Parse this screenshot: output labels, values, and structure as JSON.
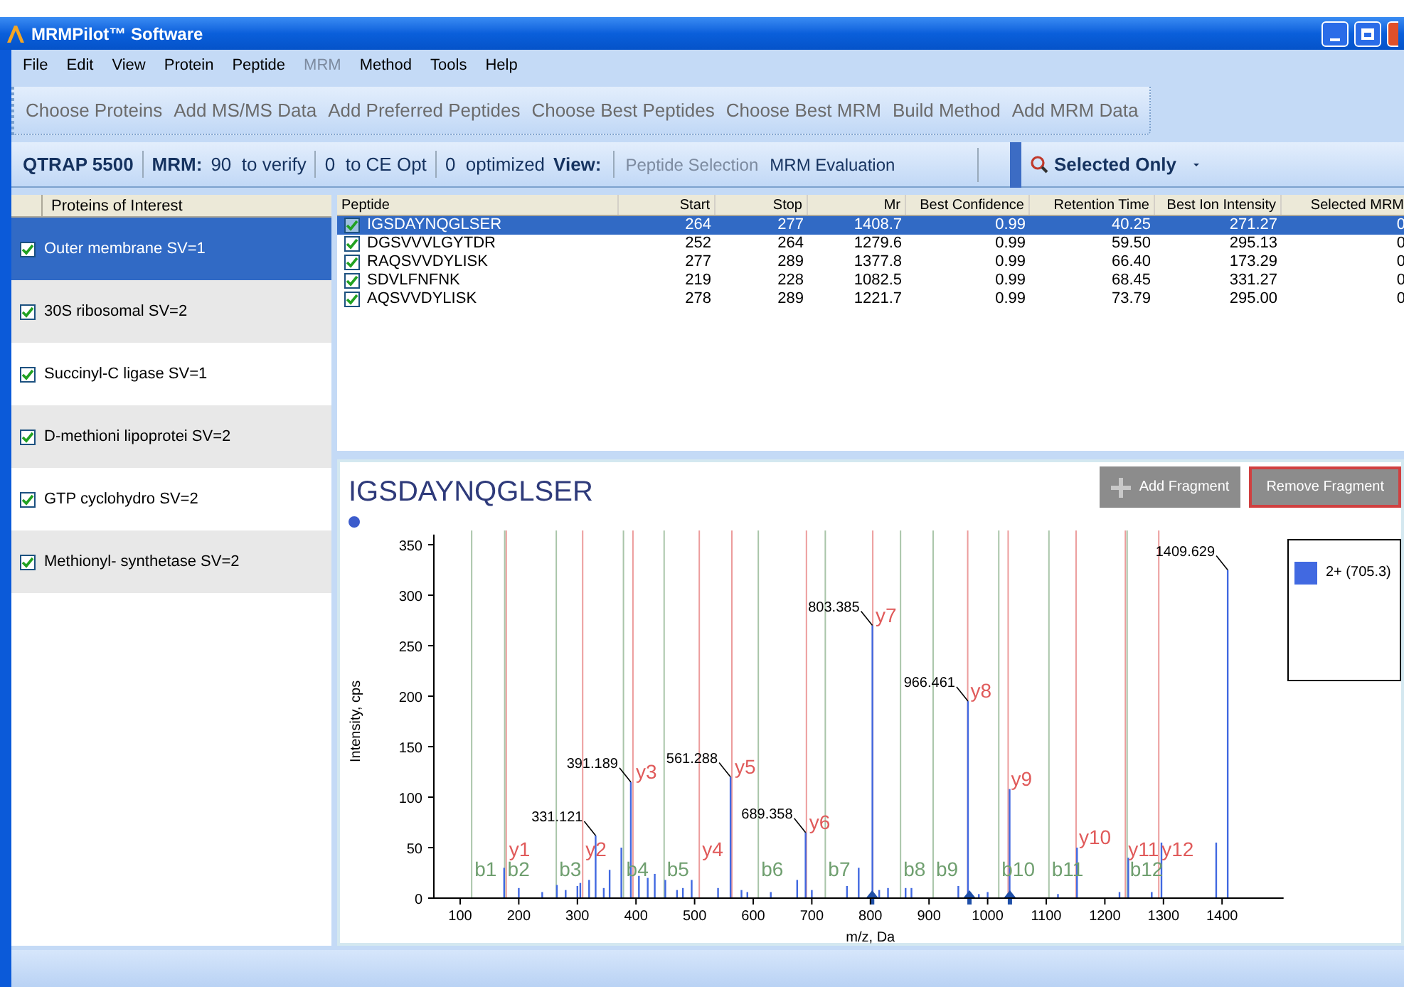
{
  "window": {
    "title": "MRMPilot™ Software"
  },
  "menu": [
    {
      "label": "File",
      "disabled": false
    },
    {
      "label": "Edit",
      "disabled": false
    },
    {
      "label": "View",
      "disabled": false
    },
    {
      "label": "Protein",
      "disabled": false
    },
    {
      "label": "Peptide",
      "disabled": false
    },
    {
      "label": "MRM",
      "disabled": true
    },
    {
      "label": "Method",
      "disabled": false
    },
    {
      "label": "Tools",
      "disabled": false
    },
    {
      "label": "Help",
      "disabled": false
    }
  ],
  "workflow": [
    "Choose Proteins",
    "Add MS/MS Data",
    "Add Preferred Peptides",
    "Choose Best Peptides",
    "Choose Best MRM",
    "Build Method",
    "Add MRM Data"
  ],
  "status_toolbar": {
    "instrument": "QTRAP 5500",
    "mrm_label": "MRM:",
    "to_verify": "90  to verify",
    "to_ce_opt": "0  to CE Opt",
    "optimized": "0  optimized",
    "view_label": "View:",
    "views": [
      {
        "label": "Peptide Selection",
        "disabled": true
      },
      {
        "label": "MRM Evaluation",
        "disabled": false
      }
    ],
    "filter": "Selected Only"
  },
  "proteins": {
    "header": "Proteins of Interest",
    "items": [
      {
        "label": "Outer membrane SV=1",
        "checked": true,
        "selected": true
      },
      {
        "label": "30S ribosomal SV=2",
        "checked": true,
        "selected": false
      },
      {
        "label": "Succinyl-C ligase SV=1",
        "checked": true,
        "selected": false
      },
      {
        "label": "D-methioni lipoprotei SV=2",
        "checked": true,
        "selected": false
      },
      {
        "label": "GTP cyclohydro SV=2",
        "checked": true,
        "selected": false
      },
      {
        "label": "Methionyl- synthetase SV=2",
        "checked": true,
        "selected": false
      }
    ]
  },
  "peptides": {
    "columns": [
      "Peptide",
      "Start",
      "Stop",
      "Mr",
      "Best Confidence",
      "Retention Time",
      "Best Ion Intensity",
      "Selected MRM"
    ],
    "rows": [
      {
        "cells": [
          "IGSDAYNQGLSER",
          "264",
          "277",
          "1408.7",
          "0.99",
          "40.25",
          "271.27",
          "0"
        ],
        "checked": true,
        "selected": true
      },
      {
        "cells": [
          "DGSVVVLGYTDR",
          "252",
          "264",
          "1279.6",
          "0.99",
          "59.50",
          "295.13",
          "0"
        ],
        "checked": true,
        "selected": false
      },
      {
        "cells": [
          "RAQSVVDYLISK",
          "277",
          "289",
          "1377.8",
          "0.99",
          "66.40",
          "173.29",
          "0"
        ],
        "checked": true,
        "selected": false
      },
      {
        "cells": [
          "SDVLFNFNK",
          "219",
          "228",
          "1082.5",
          "0.99",
          "68.45",
          "331.27",
          "0"
        ],
        "checked": true,
        "selected": false
      },
      {
        "cells": [
          "AQSVVDYLISK",
          "278",
          "289",
          "1221.7",
          "0.99",
          "73.79",
          "295.00",
          "0"
        ],
        "checked": true,
        "selected": false
      }
    ]
  },
  "spectrum": {
    "title": "IGSDAYNQGLSER",
    "buttons": [
      {
        "label": "Add Fragment",
        "kind": "add"
      },
      {
        "label": "Remove Fragment",
        "kind": "remove"
      }
    ],
    "chart_data": {
      "type": "bar",
      "xlabel": "m/z, Da",
      "ylabel": "Intensity, cps",
      "xlim": [
        55,
        1505
      ],
      "ylim": [
        0,
        360
      ],
      "xticks": [
        100,
        200,
        300,
        400,
        500,
        600,
        700,
        800,
        900,
        1000,
        1100,
        1200,
        1300,
        1400
      ],
      "yticks": [
        0,
        50,
        100,
        150,
        200,
        250,
        300,
        350
      ],
      "x": [
        175,
        200,
        240,
        265,
        280,
        300,
        305,
        320,
        331.121,
        345,
        355,
        375,
        391.189,
        405,
        420,
        432,
        450,
        470,
        480,
        495,
        540,
        561.288,
        580,
        590,
        630,
        675,
        689.358,
        700,
        760,
        780,
        803.385,
        815,
        830,
        860,
        870,
        950,
        966.461,
        985,
        1000,
        1037.5,
        1120,
        1152.5,
        1225,
        1240,
        1280,
        1296.6,
        1390,
        1409.629
      ],
      "series": [
        {
          "name": "2+ (705.3)",
          "color": "#4169e1",
          "values": [
            30,
            10,
            6,
            13,
            8,
            12,
            15,
            18,
            62,
            10,
            28,
            50,
            115,
            22,
            20,
            24,
            18,
            8,
            10,
            18,
            10,
            120,
            8,
            6,
            6,
            18,
            65,
            8,
            12,
            30,
            270,
            8,
            10,
            10,
            10,
            12,
            195,
            4,
            6,
            108,
            4,
            50,
            6,
            40,
            6,
            55,
            55,
            325
          ]
        }
      ],
      "annotations": [
        {
          "text": "331.121",
          "x": 331.121,
          "y": 62
        },
        {
          "text": "391.189",
          "x": 391.189,
          "y": 115
        },
        {
          "text": "561.288",
          "x": 561.288,
          "y": 120
        },
        {
          "text": "689.358",
          "x": 689.358,
          "y": 65
        },
        {
          "text": "803.385",
          "x": 803.385,
          "y": 270
        },
        {
          "text": "966.461",
          "x": 966.461,
          "y": 195
        },
        {
          "text": "1409.629",
          "x": 1409.629,
          "y": 325
        }
      ],
      "ref_lines": [
        {
          "axis": "x",
          "value": 119.6,
          "label": "b1",
          "color": "#6f9f6f"
        },
        {
          "axis": "x",
          "value": 178.6,
          "label": "y1",
          "color": "#e05a5a"
        },
        {
          "axis": "x",
          "value": 176,
          "label": "b2",
          "color": "#6f9f6f"
        },
        {
          "axis": "x",
          "value": 264,
          "label": "b3",
          "color": "#6f9f6f"
        },
        {
          "axis": "x",
          "value": 309,
          "label": "y2",
          "color": "#e05a5a"
        },
        {
          "axis": "x",
          "value": 378.6,
          "label": "b4",
          "color": "#6f9f6f"
        },
        {
          "axis": "x",
          "value": 394.8,
          "label": "y3",
          "color": "#e05a5a"
        },
        {
          "axis": "x",
          "value": 448,
          "label": "b5",
          "color": "#6f9f6f"
        },
        {
          "axis": "x",
          "value": 508,
          "label": "y4",
          "color": "#e05a5a"
        },
        {
          "axis": "x",
          "value": 563.6,
          "label": "y5",
          "color": "#e05a5a"
        },
        {
          "axis": "x",
          "value": 608.7,
          "label": "b6",
          "color": "#6f9f6f"
        },
        {
          "axis": "x",
          "value": 690.8,
          "label": "y6",
          "color": "#e05a5a"
        },
        {
          "axis": "x",
          "value": 723,
          "label": "b7",
          "color": "#6f9f6f"
        },
        {
          "axis": "x",
          "value": 804,
          "label": "y7",
          "color": "#e05a5a"
        },
        {
          "axis": "x",
          "value": 851.4,
          "label": "b8",
          "color": "#6f9f6f"
        },
        {
          "axis": "x",
          "value": 907,
          "label": "b9",
          "color": "#6f9f6f"
        },
        {
          "axis": "x",
          "value": 966,
          "label": "y8",
          "color": "#e05a5a"
        },
        {
          "axis": "x",
          "value": 1019,
          "label": "b10",
          "color": "#6f9f6f"
        },
        {
          "axis": "x",
          "value": 1035,
          "label": "y9",
          "color": "#e05a5a"
        },
        {
          "axis": "x",
          "value": 1104.6,
          "label": "b11",
          "color": "#6f9f6f"
        },
        {
          "axis": "x",
          "value": 1150.9,
          "label": "y10",
          "color": "#e05a5a"
        },
        {
          "axis": "x",
          "value": 1235,
          "label": "y11",
          "color": "#e05a5a"
        },
        {
          "axis": "x",
          "value": 1238,
          "label": "b12",
          "color": "#6f9f6f"
        },
        {
          "axis": "x",
          "value": 1292,
          "label": "y12",
          "color": "#e05a5a"
        }
      ]
    }
  }
}
